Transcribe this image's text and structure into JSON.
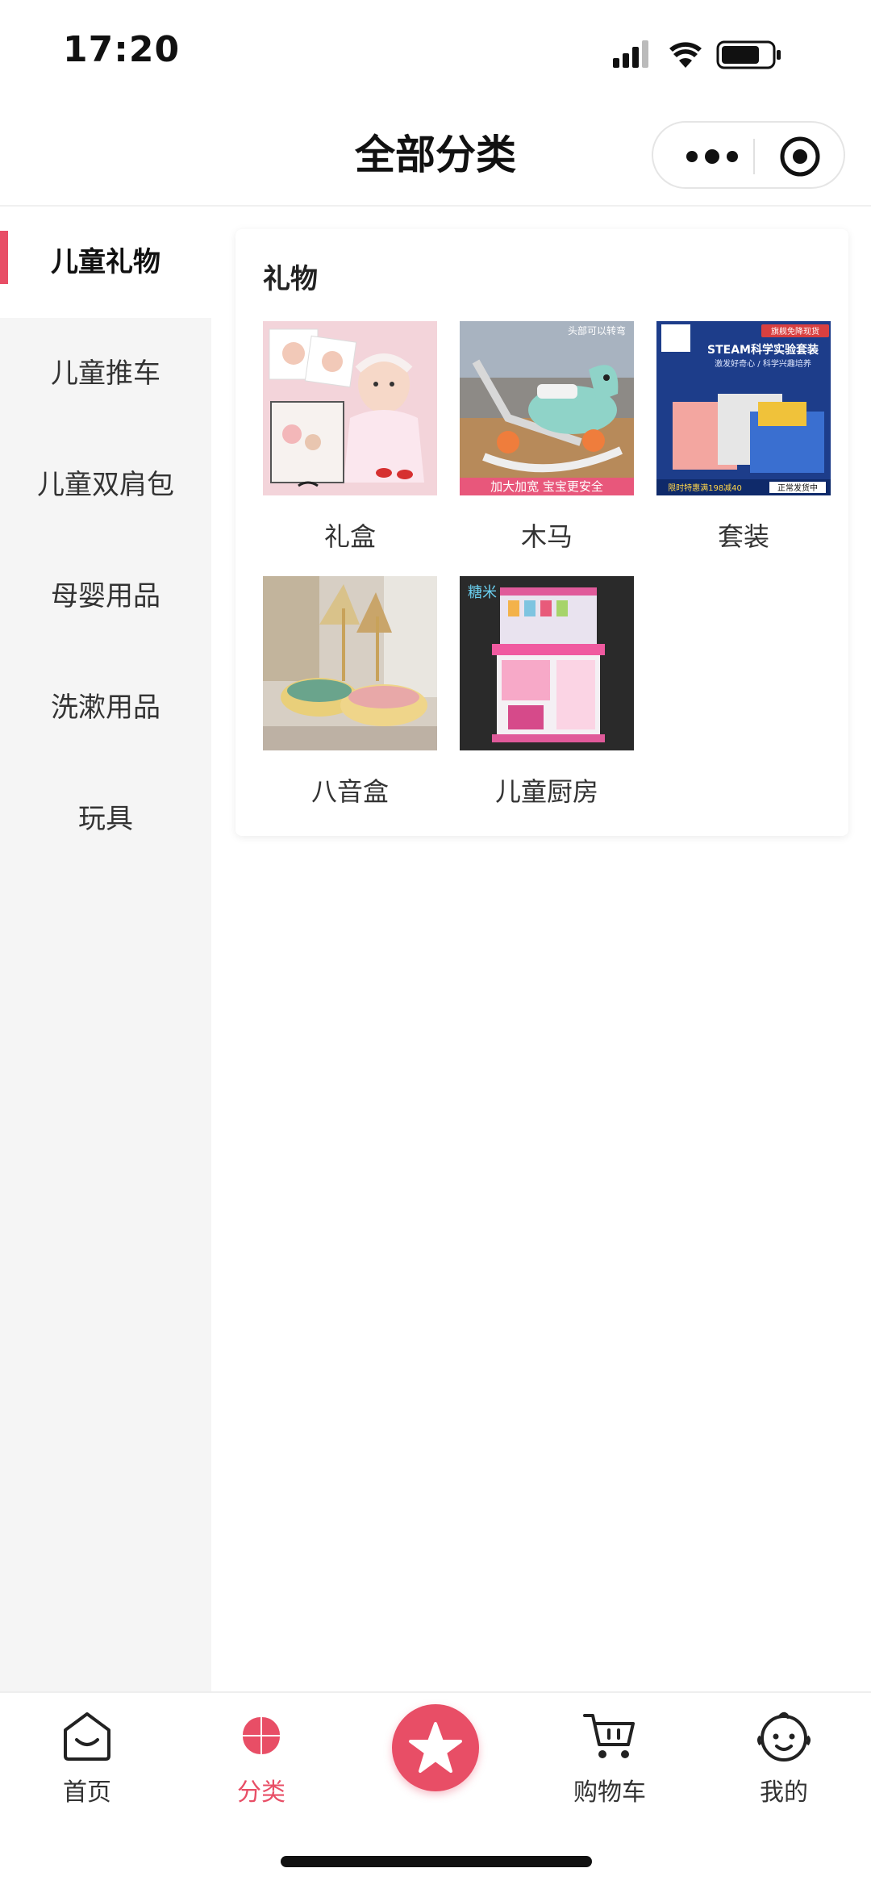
{
  "status_bar": {
    "time": "17:20"
  },
  "nav": {
    "title": "全部分类"
  },
  "sidebar": {
    "items": [
      {
        "label": "儿童礼物"
      },
      {
        "label": "儿童推车"
      },
      {
        "label": "儿童双肩包"
      },
      {
        "label": "母婴用品"
      },
      {
        "label": "洗漱用品"
      },
      {
        "label": "玩具"
      }
    ]
  },
  "content": {
    "section_title": "礼物",
    "products": [
      {
        "label": "礼盒",
        "image": "gift-box-photo"
      },
      {
        "label": "木马",
        "image": "rocking-horse-photo",
        "banner": "加大加宽  宝宝更安全",
        "tag": "头部可以转弯"
      },
      {
        "label": "套装",
        "image": "steam-kit-photo",
        "banner_top": "STEAM科学实验套装",
        "sub": "激发好奇心 / 科学兴趣培养",
        "corner": "旗舰免降现货",
        "bottom": "限时特惠满198减40",
        "ship": "正常发货中"
      },
      {
        "label": "八音盒",
        "image": "music-box-photo"
      },
      {
        "label": "儿童厨房",
        "image": "kids-kitchen-photo"
      }
    ]
  },
  "tabbar": {
    "items": [
      {
        "label": "首页",
        "icon": "home-icon"
      },
      {
        "label": "分类",
        "icon": "category-icon",
        "active": true
      },
      {
        "label": "",
        "icon": "star-icon"
      },
      {
        "label": "购物车",
        "icon": "cart-icon"
      },
      {
        "label": "我的",
        "icon": "baby-face-icon"
      }
    ]
  },
  "colors": {
    "accent": "#e84e66",
    "sidebar_bg": "#f5f5f5"
  }
}
